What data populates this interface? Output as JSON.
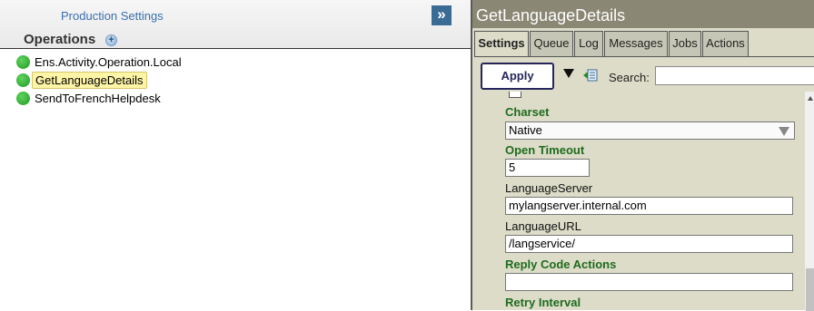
{
  "left": {
    "production_settings_link": "Production Settings",
    "operations_title": "Operations",
    "add_label": "+",
    "toggle_label": "»",
    "operations": [
      {
        "label": "Ens.Activity.Operation.Local",
        "status": "running",
        "selected": false
      },
      {
        "label": "GetLanguageDetails",
        "status": "running",
        "selected": true
      },
      {
        "label": "SendToFrenchHelpdesk",
        "status": "running",
        "selected": false
      }
    ]
  },
  "right": {
    "title": "GetLanguageDetails",
    "tabs": [
      {
        "label": "Settings",
        "active": true
      },
      {
        "label": "Queue",
        "active": false
      },
      {
        "label": "Log",
        "active": false
      },
      {
        "label": "Messages",
        "active": false
      },
      {
        "label": "Jobs",
        "active": false
      },
      {
        "label": "Actions",
        "active": false
      }
    ],
    "toolbar": {
      "apply_label": "Apply",
      "search_label": "Search:",
      "search_value": ""
    },
    "fields": {
      "charset": {
        "label": "Charset",
        "value": "Native"
      },
      "open_timeout": {
        "label": "Open Timeout",
        "value": "5"
      },
      "language_server": {
        "label": "LanguageServer",
        "value": "mylangserver.internal.com"
      },
      "language_url": {
        "label": "LanguageURL",
        "value": "/langservice/"
      },
      "reply_code_actions": {
        "label": "Reply Code Actions",
        "value": ""
      },
      "retry_interval": {
        "label": "Retry Interval"
      }
    }
  },
  "colors": {
    "status_running": "#2aa02a",
    "setting_label_green": "#1e6b1e",
    "panel_background": "#dcdcc8",
    "title_bar": "#8a8774",
    "accent_blue": "#3a6b95"
  }
}
